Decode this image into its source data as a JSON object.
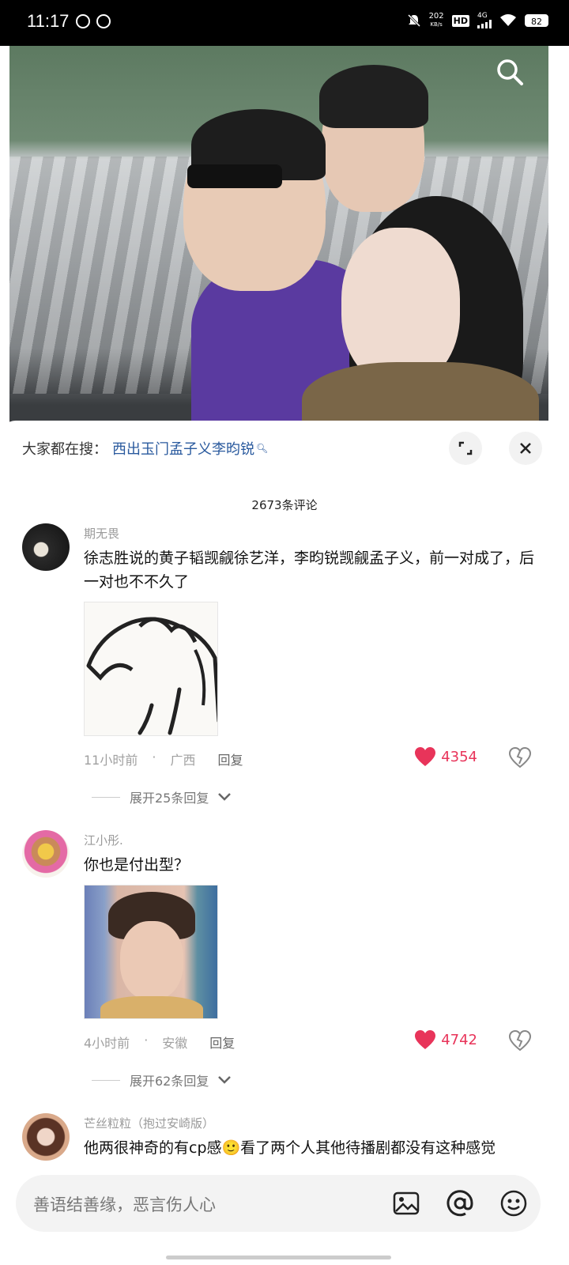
{
  "status": {
    "time": "11:17",
    "net_speed_top": "202",
    "net_speed_bottom": "KB/s",
    "hd": "HD",
    "network": "4G",
    "battery": "82"
  },
  "trending": {
    "prefix": "大家都在搜：",
    "keyword": "西出玉门孟子义李昀锐"
  },
  "comments_count": "2673条评论",
  "comments": [
    {
      "user": "期无畏",
      "text": "徐志胜说的黄子韬觊觎徐艺洋，李昀锐觊觎孟子义，前一对成了，后一对也不不久了",
      "time": "11小时前",
      "location": "广西",
      "reply_label": "回复",
      "likes": "4354",
      "expand": "展开25条回复"
    },
    {
      "user": "江小彤.",
      "text": "你也是付出型？",
      "time": "4小时前",
      "location": "安徽",
      "reply_label": "回复",
      "likes": "4742",
      "expand": "展开62条回复"
    },
    {
      "user": "芒丝粒粒（抱过安崎版）",
      "text": "他两很神奇的有cp感🙂看了两个人其他待播剧都没有这种感觉"
    }
  ],
  "input": {
    "placeholder": "善语结善缘，恶言伤人心"
  },
  "colors": {
    "accent_like": "#e8345a",
    "keyword": "#2a5a9e"
  }
}
